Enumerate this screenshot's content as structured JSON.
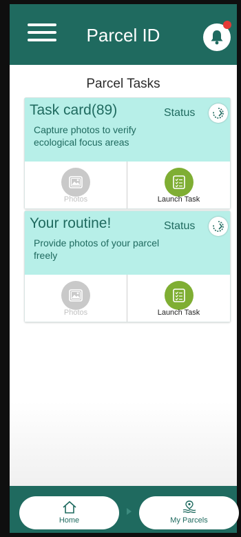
{
  "header": {
    "title": "Parcel ID",
    "menu_icon": "hamburger-menu-icon",
    "notification_icon": "bell-icon",
    "notification_dot_color": "#e53935"
  },
  "section": {
    "title": "Parcel Tasks"
  },
  "tasks": [
    {
      "title": "Task card(89)",
      "description": "Capture photos to verify ecological focus areas",
      "status_label": "Status",
      "status_icon": "refresh-status-icon",
      "actions": {
        "photos_label": "Photos",
        "photos_enabled": false,
        "launch_label": "Launch Task"
      }
    },
    {
      "title": "Your routine!",
      "description": "Provide photos of your parcel freely",
      "status_label": "Status",
      "status_icon": "refresh-status-icon",
      "actions": {
        "photos_label": "Photos",
        "photos_enabled": false,
        "launch_label": "Launch Task"
      }
    }
  ],
  "bottom_nav": {
    "items": [
      {
        "label": "Home",
        "icon": "home-icon"
      },
      {
        "label": "My Parcels",
        "icon": "parcels-icon"
      }
    ]
  },
  "colors": {
    "primary": "#1f6a5f",
    "card_header": "#b7efe8",
    "launch_button": "#7fae33",
    "disabled": "#c9c9c9"
  }
}
